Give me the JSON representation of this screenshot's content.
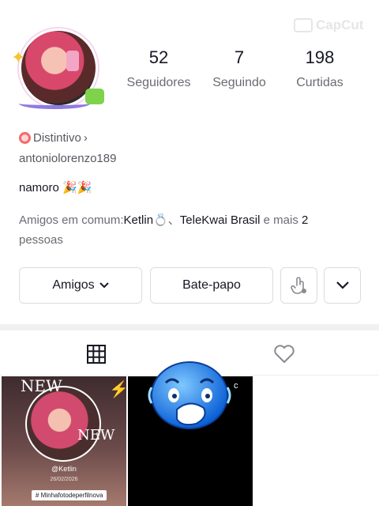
{
  "watermark": {
    "text": "CapCut"
  },
  "profile": {
    "stats": [
      {
        "value": "52",
        "label": "Seguidores"
      },
      {
        "value": "7",
        "label": "Seguindo"
      },
      {
        "value": "198",
        "label": "Curtidas"
      }
    ],
    "badge_label": "Distintivo",
    "badge_chevron": "›",
    "username": "antoniolorenzo189",
    "bio": "namoro 🎉🎉",
    "mutual": {
      "prefix": "Amigos em comum:",
      "name1": "Ketlin",
      "ring": "💍、",
      "name2": "TeleKwai Brasil",
      "middle": " e mais ",
      "count": "2",
      "suffix": "pessoas"
    }
  },
  "actions": {
    "friends_label": "Amigos",
    "friends_chevron": "⌄",
    "chat_label": "Bate-papo",
    "more_chevron": "⌄"
  },
  "tabs": [
    {
      "icon": "grid-icon"
    },
    {
      "icon": "heart-icon"
    }
  ],
  "videos": [
    {
      "sticker_top": "NEW",
      "sticker_bottom": "NEW",
      "caption": "@Ketlin",
      "date": "26/02/2026",
      "hashtag": "# Minhafotodeperfilnova"
    },
    {
      "overlay_text": "c"
    }
  ],
  "colors": {
    "text_primary": "#161823",
    "text_secondary": "#6b6b73",
    "border": "#dcdce0",
    "badge": "#f26b6b"
  }
}
